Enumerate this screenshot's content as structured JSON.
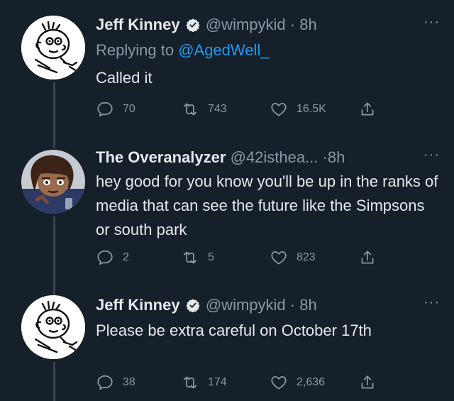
{
  "tweets": [
    {
      "name": "Jeff Kinney",
      "handle": "@wimpykid",
      "dot": "·",
      "time": "8h",
      "reply_prefix": "Replying to ",
      "reply_mention": "@AgedWell_",
      "text": "Called it",
      "replies": "70",
      "retweets": "743",
      "likes": "16.5K",
      "more": "···",
      "verified": true
    },
    {
      "name": "The Overanalyzer",
      "handle": "@42isthea...",
      "dot": "·",
      "time": "8h",
      "text": "hey good for you know you'll be up in the ranks of media that can see the future like the Simpsons or south park",
      "replies": "2",
      "retweets": "5",
      "likes": "823",
      "more": "···",
      "verified": false
    },
    {
      "name": "Jeff Kinney",
      "handle": "@wimpykid",
      "dot": "·",
      "time": "8h",
      "text": "Please be extra careful on October 17th",
      "replies": "38",
      "retweets": "174",
      "likes": "2,636",
      "more": "···",
      "verified": true
    }
  ],
  "colors": {
    "background": "#15202b",
    "text": "#e7e9ea",
    "secondary": "#8b98a5",
    "link": "#1d9bf0",
    "verified": "#e7e9ea"
  },
  "icons": {
    "reply": "speech-bubble-icon",
    "retweet": "retweet-arrows-icon",
    "like": "heart-icon",
    "share": "share-upload-icon",
    "verified": "verified-badge-icon",
    "more": "ellipsis-icon"
  }
}
